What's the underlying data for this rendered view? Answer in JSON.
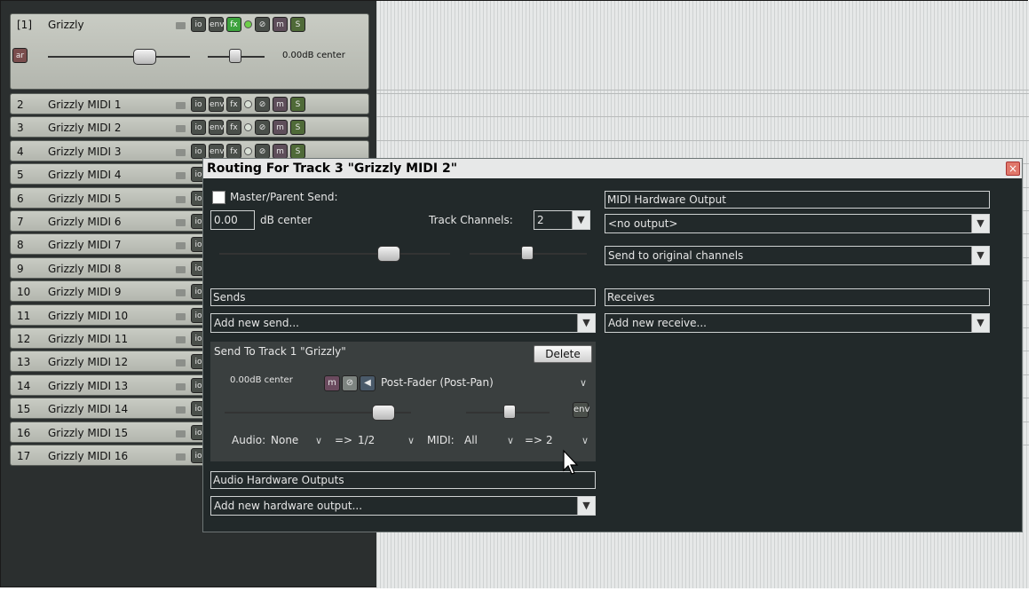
{
  "tracks": [
    {
      "num": "[1]",
      "name": "Grizzly",
      "fx_on": true,
      "vol": "0.00dB center",
      "ar": "ar"
    },
    {
      "num": "2",
      "name": "Grizzly MIDI 1"
    },
    {
      "num": "3",
      "name": "Grizzly MIDI 2"
    },
    {
      "num": "4",
      "name": "Grizzly MIDI 3"
    },
    {
      "num": "5",
      "name": "Grizzly MIDI 4"
    },
    {
      "num": "6",
      "name": "Grizzly MIDI 5"
    },
    {
      "num": "7",
      "name": "Grizzly MIDI 6"
    },
    {
      "num": "8",
      "name": "Grizzly MIDI 7"
    },
    {
      "num": "9",
      "name": "Grizzly MIDI 8"
    },
    {
      "num": "10",
      "name": "Grizzly MIDI 9"
    },
    {
      "num": "11",
      "name": "Grizzly MIDI 10"
    },
    {
      "num": "12",
      "name": "Grizzly MIDI 11"
    },
    {
      "num": "13",
      "name": "Grizzly MIDI 12"
    },
    {
      "num": "14",
      "name": "Grizzly MIDI 13"
    },
    {
      "num": "15",
      "name": "Grizzly MIDI 14"
    },
    {
      "num": "16",
      "name": "Grizzly MIDI 15"
    },
    {
      "num": "17",
      "name": "Grizzly MIDI 16"
    }
  ],
  "track_buttons": {
    "io": "io",
    "env": "env",
    "fx": "fx",
    "m": "m",
    "s": "S"
  },
  "dialog": {
    "title": "Routing For Track 3 \"Grizzly MIDI 2\"",
    "close": "×",
    "master_send": "Master/Parent Send:",
    "volume_value": "0.00",
    "db_center": "dB  center",
    "track_channels_label": "Track Channels:",
    "track_channels_value": "2",
    "midi_hw_output_header": "MIDI Hardware Output",
    "midi_output_value": "<no output>",
    "midi_channels_value": "Send to original channels",
    "sends_header": "Sends",
    "add_send": "Add new send...",
    "receives_header": "Receives",
    "add_receive": "Add new receive...",
    "send_to": "Send To Track 1 \"Grizzly\"",
    "delete": "Delete",
    "send_vol": "0.00dB center",
    "send_mode": "Post-Fader (Post-Pan)",
    "audio_label": "Audio:",
    "audio_src": "None",
    "arrow1": "=>",
    "audio_dst": "1/2",
    "midi_label": "MIDI:",
    "midi_src": "All",
    "arrow2": "=>",
    "midi_dst": "2",
    "audio_hw_header": "Audio Hardware Outputs",
    "add_hw_output": "Add new hardware output...",
    "send_m": "m",
    "send_env": "env"
  }
}
